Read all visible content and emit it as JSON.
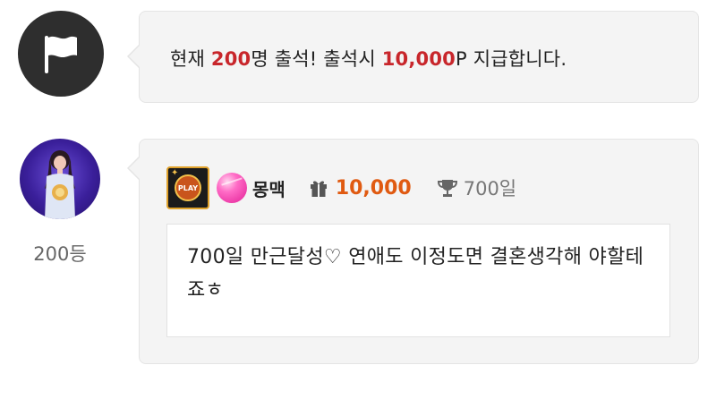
{
  "notice": {
    "icon": "flag-icon",
    "text_prefix": "현재 ",
    "count": "200",
    "text_mid": "명 출석! 출석시 ",
    "points": "10,000",
    "text_suffix": "P 지급합니다.",
    "highlight_color": "#c8262b"
  },
  "entry": {
    "rank": "200등",
    "badge": {
      "icon": "play-badge-icon",
      "text": "PLAY"
    },
    "level_icon": "candy-level-icon",
    "nickname": "몽맥",
    "gift_icon": "gift-icon",
    "points": "10,000",
    "points_color": "#e05a11",
    "trophy_icon": "trophy-icon",
    "days": "700일",
    "message": "700일 만근달성♡ 연애도 이정도면 결혼생각해 야할테죠ㅎ"
  }
}
